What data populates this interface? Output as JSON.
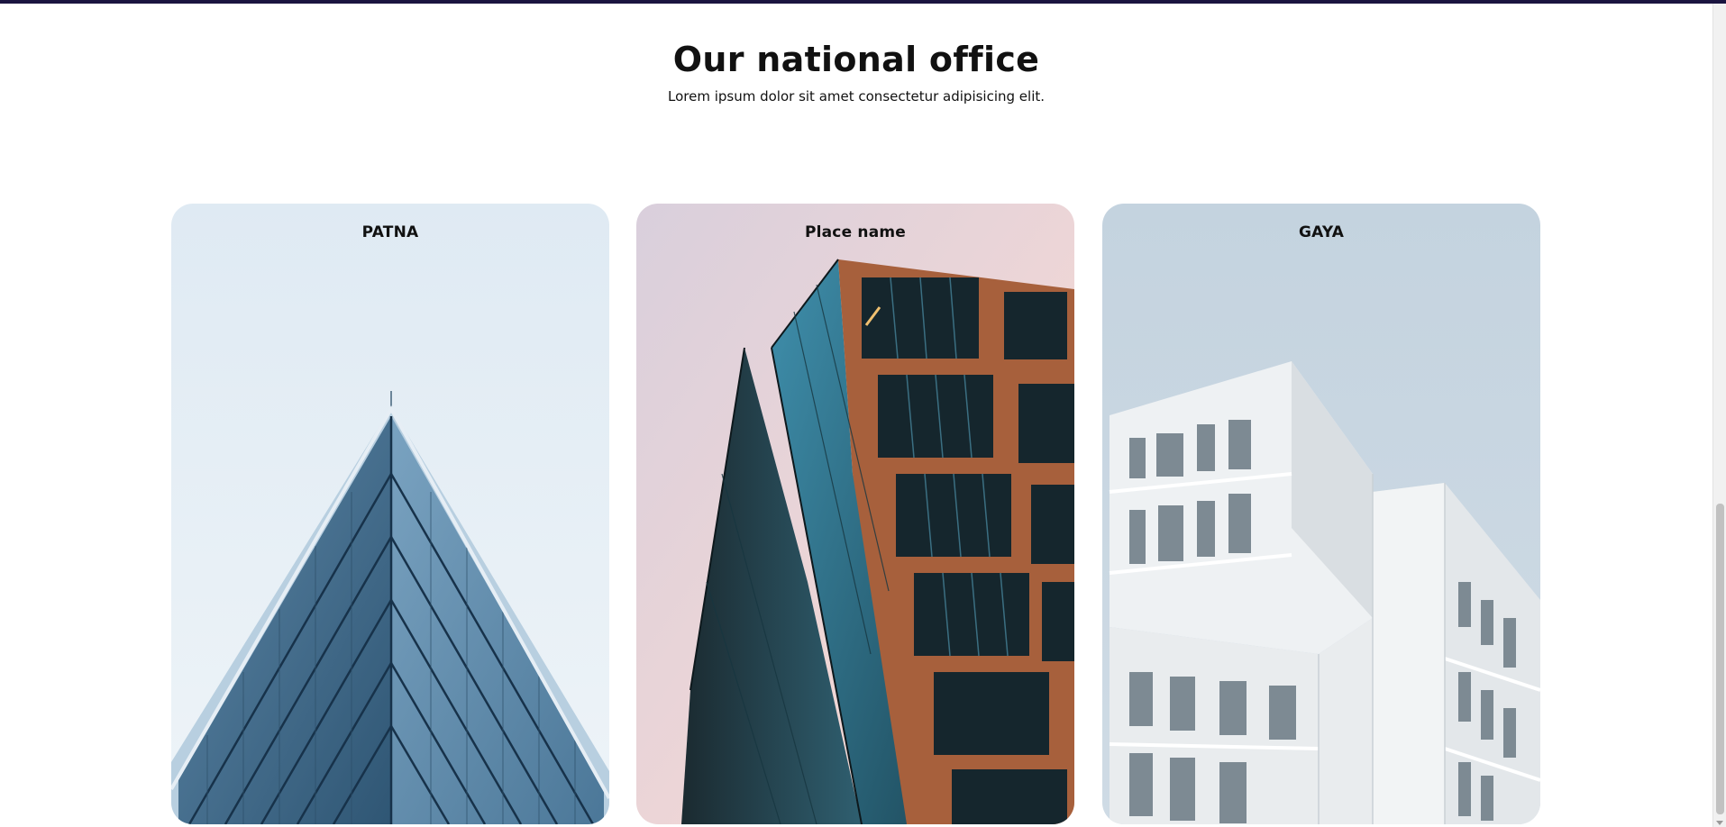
{
  "section": {
    "title": "Our national office",
    "subtitle": "Lorem ipsum dolor sit amet consectetur adipisicing elit."
  },
  "offices": [
    {
      "label": "PATNA",
      "image": "glass-pyramid-building-photo"
    },
    {
      "label": "Place name",
      "image": "copper-glass-tower-photo"
    },
    {
      "label": "GAYA",
      "image": "white-modular-building-photo"
    }
  ],
  "colors": {
    "top_bar": "#1a1440",
    "sky_light": "#e6eff6",
    "glass_blue": "#4d7a99",
    "copper": "#b5683f"
  }
}
